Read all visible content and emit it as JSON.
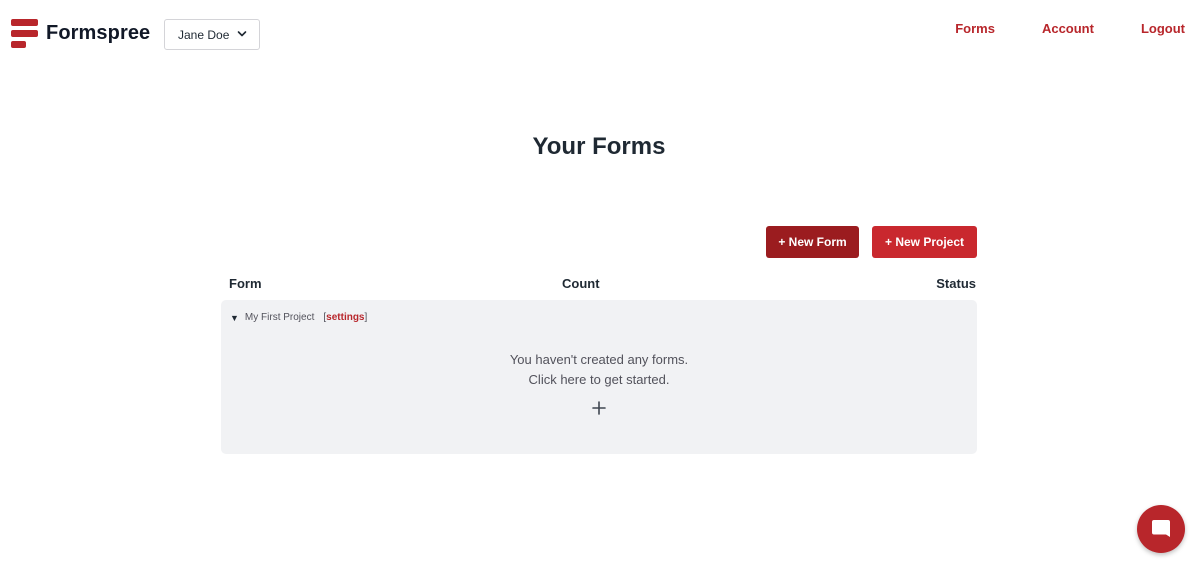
{
  "brand": {
    "name": "Formspree",
    "color": "#b8262b"
  },
  "user_select": {
    "value": "Jane Doe",
    "icon": "chevron-down-icon"
  },
  "nav": {
    "forms": "Forms",
    "account": "Account",
    "logout": "Logout"
  },
  "page": {
    "title": "Your Forms"
  },
  "actions": {
    "new_form": "+ New Form",
    "new_project": "+ New Project"
  },
  "table": {
    "columns": [
      "Form",
      "Count",
      "Status"
    ]
  },
  "project": {
    "name": "My First Project",
    "settings_label": "settings",
    "empty_line1": "You haven't created any forms.",
    "empty_line2": "Click here to get started."
  },
  "icons": {
    "expand": "triangle-down-icon",
    "add": "plus-icon",
    "chat": "chat-bubble-icon"
  }
}
